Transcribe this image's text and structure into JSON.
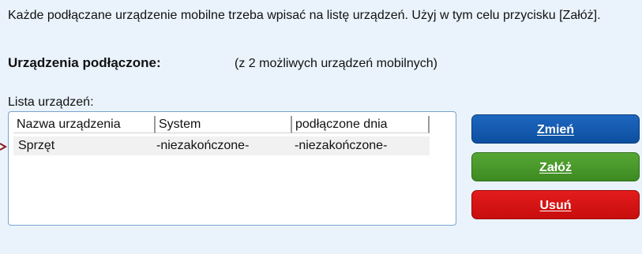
{
  "info": {
    "text": "Każde podłączane urządzenie mobilne trzeba wpisać na listę urządzeń. Użyj w tym celu przycisku [Załóż]."
  },
  "devices": {
    "title": "Urządzenia podłączone:",
    "subtitle": "(z 2 możliwych urządzeń mobilnych)"
  },
  "list": {
    "label": "Lista urządzeń:",
    "columns": [
      "Nazwa urządzenia",
      "System",
      "podłączone dnia"
    ],
    "rows": [
      {
        "name": "Sprzęt",
        "system": "-niezakończone-",
        "date": "-niezakończone-"
      }
    ]
  },
  "buttons": {
    "change": "Zmień",
    "create": "Załóż",
    "delete": "Usuń"
  },
  "colors": {
    "change": "#0c4f9f",
    "create": "#3d8a22",
    "delete": "#c80d0d",
    "background": "#eaf3fb"
  },
  "icons": {
    "pointer": "pointer-arrow-icon"
  }
}
